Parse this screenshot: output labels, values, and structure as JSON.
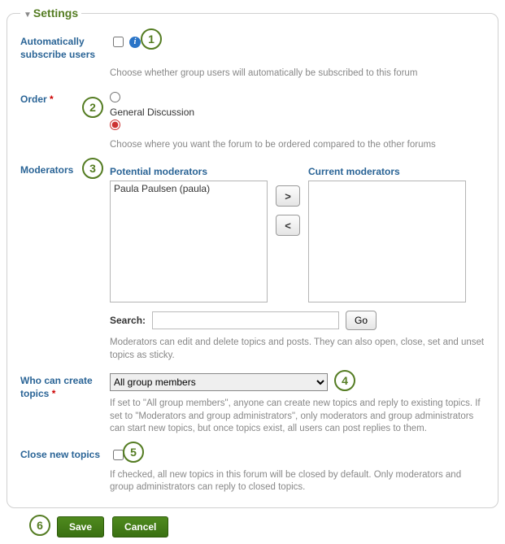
{
  "legend": "Settings",
  "callouts": {
    "c1": "1",
    "c2": "2",
    "c3": "3",
    "c4": "4",
    "c5": "5",
    "c6": "6"
  },
  "subscribe": {
    "label": "Automatically subscribe users",
    "help": "Choose whether group users will automatically be subscribed to this forum"
  },
  "order": {
    "label": "Order",
    "option_general": "General Discussion",
    "help": "Choose where you want the forum to be ordered compared to the other forums"
  },
  "moderators": {
    "label": "Moderators",
    "potential_title": "Potential moderators",
    "current_title": "Current moderators",
    "potential_items": [
      "Paula Paulsen (paula)"
    ],
    "btn_add": ">",
    "btn_remove": "<",
    "search_label": "Search:",
    "go": "Go",
    "help": "Moderators can edit and delete topics and posts. They can also open, close, set and unset topics as sticky."
  },
  "who": {
    "label": "Who can create topics",
    "selected": "All group members",
    "help": "If set to \"All group members\", anyone can create new topics and reply to existing topics. If set to \"Moderators and group administrators\", only moderators and group administrators can start new topics, but once topics exist, all users can post replies to them."
  },
  "close": {
    "label": "Close new topics",
    "help": "If checked, all new topics in this forum will be closed by default. Only moderators and group administrators can reply to closed topics."
  },
  "buttons": {
    "save": "Save",
    "cancel": "Cancel"
  }
}
